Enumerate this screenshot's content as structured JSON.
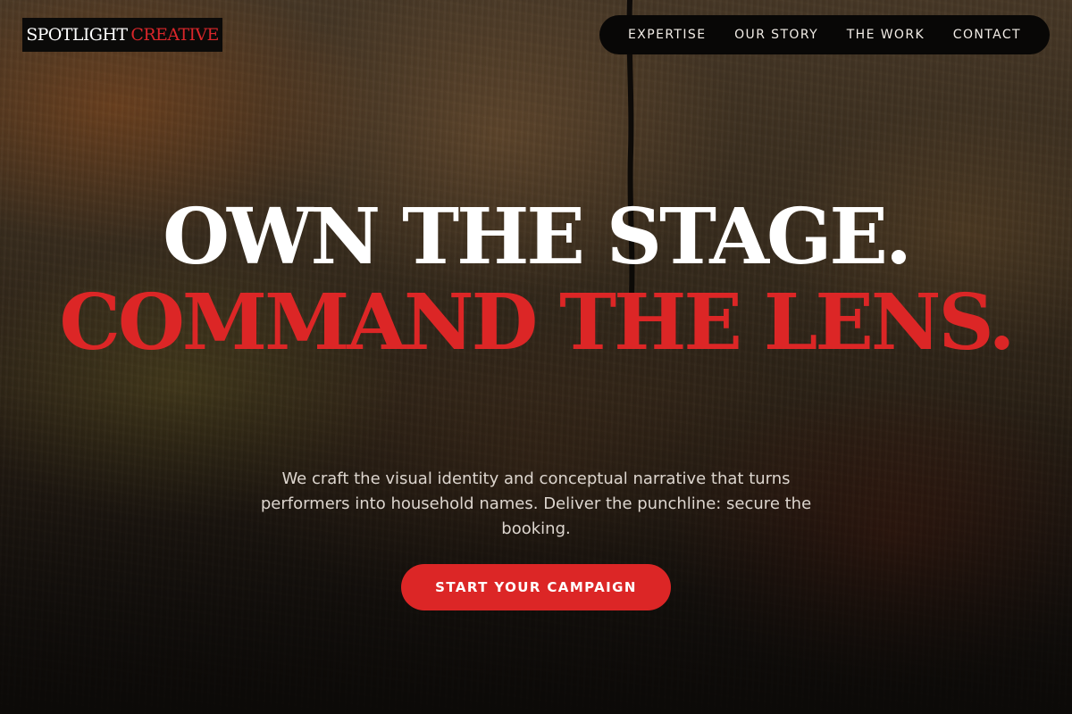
{
  "brand": {
    "name_part1": "SPOTLIGHT",
    "name_part2": "CREATIVE"
  },
  "nav": {
    "items": [
      {
        "label": "EXPERTISE"
      },
      {
        "label": "OUR STORY"
      },
      {
        "label": "THE WORK"
      },
      {
        "label": "CONTACT"
      }
    ]
  },
  "hero": {
    "headline_line1": "OWN THE STAGE.",
    "headline_line2": "COMMAND THE LENS.",
    "subtitle": "We craft the visual identity and conceptual narrative that turns performers into household names. Deliver the punchline: secure the booking.",
    "cta_label": "START YOUR CAMPAIGN"
  },
  "colors": {
    "accent": "#dc2626",
    "nav_background": "#080706",
    "text_light": "#ffffff"
  }
}
